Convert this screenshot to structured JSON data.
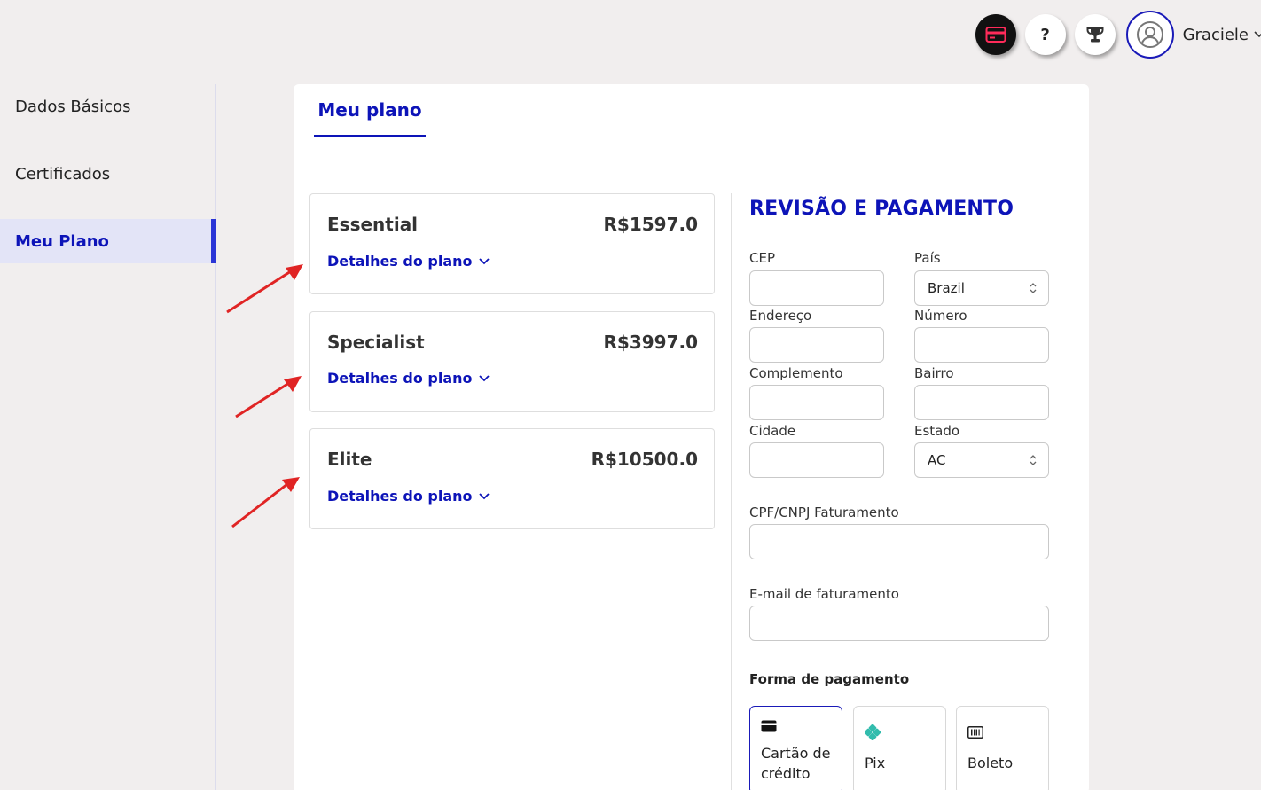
{
  "header": {
    "user_name": "Graciele",
    "icons": [
      "credit-card-icon",
      "help-icon",
      "trophy-icon",
      "user-avatar-icon"
    ],
    "help_glyph": "?"
  },
  "sidebar": {
    "items": [
      {
        "label": "Dados Básicos"
      },
      {
        "label": "Certificados"
      },
      {
        "label": "Meu Plano",
        "active": true
      }
    ]
  },
  "tabs": {
    "active": "Meu plano"
  },
  "plans": [
    {
      "name": "Essential",
      "price": "R$1597.0",
      "details": "Detalhes do plano"
    },
    {
      "name": "Specialist",
      "price": "R$3997.0",
      "details": "Detalhes do plano"
    },
    {
      "name": "Elite",
      "price": "R$10500.0",
      "details": "Detalhes do plano"
    }
  ],
  "form": {
    "title": "REVISÃO E PAGAMENTO",
    "cep": {
      "label": "CEP",
      "value": ""
    },
    "pais": {
      "label": "País",
      "value": "Brazil"
    },
    "endereco": {
      "label": "Endereço",
      "value": ""
    },
    "numero": {
      "label": "Número",
      "value": ""
    },
    "complemento": {
      "label": "Complemento",
      "value": ""
    },
    "bairro": {
      "label": "Bairro",
      "value": ""
    },
    "cidade": {
      "label": "Cidade",
      "value": ""
    },
    "estado": {
      "label": "Estado",
      "value": "AC"
    },
    "cpf": {
      "label": "CPF/CNPJ Faturamento",
      "value": ""
    },
    "email": {
      "label": "E-mail de faturamento",
      "value": ""
    },
    "payment": {
      "label": "Forma de pagamento",
      "options": [
        {
          "label_line1": "Cartão de",
          "label_line2": "crédito",
          "icon": "credit-card-icon",
          "selected": true
        },
        {
          "label": "Pix",
          "icon": "pix-icon"
        },
        {
          "label": "Boleto",
          "icon": "barcode-icon"
        }
      ]
    }
  },
  "colors": {
    "accent": "#0d14b8",
    "annotation_arrow": "#e02424",
    "pix": "#32bcad"
  }
}
